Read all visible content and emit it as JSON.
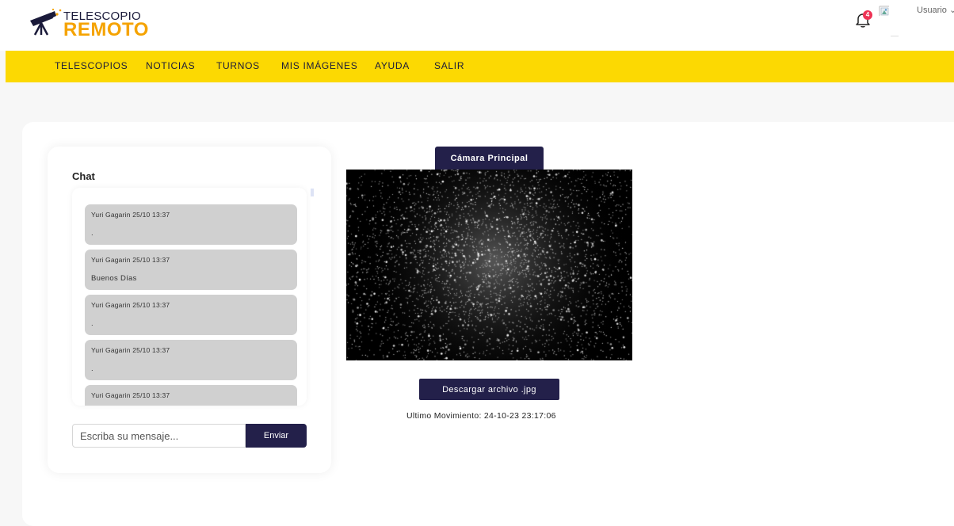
{
  "brand": {
    "line1": "TELESCOPIO",
    "line2": "REMOTO",
    "accent": "#f5a300"
  },
  "header": {
    "notification_count": "4",
    "user_label": "Usuario ⌄"
  },
  "nav": {
    "items": [
      {
        "label": "TELESCOPIOS"
      },
      {
        "label": "NOTICIAS"
      },
      {
        "label": "TURNOS"
      },
      {
        "label": "MIS IMÁGENES"
      },
      {
        "label": "AYUDA"
      },
      {
        "label": "SALIR"
      }
    ],
    "color": "#fcd902"
  },
  "chat": {
    "title": "Chat",
    "messages": [
      {
        "meta": "Yuri Gagarin 25/10 13:37",
        "text": "."
      },
      {
        "meta": "Yuri Gagarin 25/10 13:37",
        "text": "Buenos Días"
      },
      {
        "meta": "Yuri Gagarin 25/10 13:37",
        "text": "."
      },
      {
        "meta": "Yuri Gagarin 25/10 13:37",
        "text": "."
      },
      {
        "meta": "Yuri Gagarin 25/10 13:37",
        "text": ""
      }
    ],
    "input_placeholder": "Escriba su mensaje...",
    "send_label": "Enviar"
  },
  "camera": {
    "tab_label": "Cámara Principal",
    "download_label": "Descargar archivo .jpg",
    "last_movement": "Ultimo Movimiento: 24-10-23 23:17:06"
  },
  "colors": {
    "primary_dark": "#23204a",
    "badge": "#ee3355"
  }
}
